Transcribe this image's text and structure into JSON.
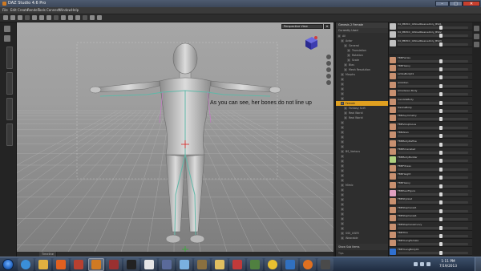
{
  "window": {
    "title": "DAZ Studio 4.6 Pro"
  },
  "menu": [
    {
      "label": "File"
    },
    {
      "label": "Edit"
    },
    {
      "label": "Create"
    },
    {
      "label": "Render"
    },
    {
      "label": "Tools"
    },
    {
      "label": "Connect"
    },
    {
      "label": "Window"
    },
    {
      "label": "Help"
    }
  ],
  "viewport": {
    "camera_dropdown": "Perspective View",
    "annotation": "As you can see, her bones do not line up"
  },
  "viewport_tabs": [
    {
      "label": "Timeline"
    }
  ],
  "scene": {
    "header": "Genesis 2 Female",
    "subheader": "Currently Used",
    "tree": [
      {
        "label": "All",
        "indent": 0
      },
      {
        "label": "Actor",
        "indent": 1
      },
      {
        "label": "General",
        "indent": 2
      },
      {
        "label": "Translation",
        "indent": 3
      },
      {
        "label": "Rotation",
        "indent": 3
      },
      {
        "label": "Scale",
        "indent": 3
      },
      {
        "label": "Bias",
        "indent": 2
      },
      {
        "label": "Mesh Resolution",
        "indent": 2
      },
      {
        "label": "Morphs",
        "indent": 1
      },
      {
        "label": "",
        "indent": 1
      },
      {
        "label": "",
        "indent": 1
      },
      {
        "label": "",
        "indent": 1
      },
      {
        "label": "",
        "indent": 1
      },
      {
        "label": "",
        "indent": 1
      },
      {
        "label": "Female",
        "indent": 1,
        "selected": true
      },
      {
        "label": "Fantasy Scifi",
        "indent": 2
      },
      {
        "label": "Real World",
        "indent": 2
      },
      {
        "label": "Real World",
        "indent": 2
      },
      {
        "label": "",
        "indent": 1
      },
      {
        "label": "",
        "indent": 1
      },
      {
        "label": "",
        "indent": 1
      },
      {
        "label": "",
        "indent": 1
      },
      {
        "label": "",
        "indent": 1
      },
      {
        "label": "",
        "indent": 1
      },
      {
        "label": "BS_Various",
        "indent": 1
      },
      {
        "label": "",
        "indent": 1
      },
      {
        "label": "",
        "indent": 1
      },
      {
        "label": "",
        "indent": 1
      },
      {
        "label": "",
        "indent": 1
      },
      {
        "label": "",
        "indent": 1
      },
      {
        "label": "",
        "indent": 1
      },
      {
        "label": "Mimic",
        "indent": 1
      },
      {
        "label": "",
        "indent": 1
      },
      {
        "label": "",
        "indent": 1
      },
      {
        "label": "",
        "indent": 1
      },
      {
        "label": "",
        "indent": 1
      },
      {
        "label": "",
        "indent": 1
      },
      {
        "label": "",
        "indent": 1
      },
      {
        "label": "",
        "indent": 1
      },
      {
        "label": "",
        "indent": 1
      },
      {
        "label": "",
        "indent": 1
      },
      {
        "label": "SSS_USER",
        "indent": 1
      },
      {
        "label": "Wearable",
        "indent": 1
      }
    ],
    "footer": "Show Sub Items",
    "footer2": "Tips"
  },
  "morphs": [
    {
      "name": "V4_PBMCC_04SkelPassiveOnly_BS01",
      "value": "",
      "level": 0.62,
      "thumb": "#c0c0c0"
    },
    {
      "name": "V4_PBMCC_04SkelPassiveOnly_BS02",
      "value": "",
      "level": 0.62,
      "thumb": "#c0c0c0"
    },
    {
      "name": "V4_PBMCC_04SkelPassiveOnly_BS03",
      "value": "",
      "level": 0.62,
      "thumb": "#c0c0c0"
    },
    {
      "name": "",
      "value": "",
      "level": 0.0,
      "thumb": "#2a2a2a"
    },
    {
      "name": "FBMFairies",
      "value": "",
      "level": 0.62,
      "thumb": "#c89070"
    },
    {
      "name": "FBMHeavy",
      "value": "",
      "level": 0.62,
      "thumb": "#c89070"
    },
    {
      "name": "LimbsBody01",
      "value": "",
      "level": 0.62,
      "thumb": "#c89070"
    },
    {
      "name": "Ambition",
      "value": "",
      "level": 0.62,
      "thumb": "#c89070"
    },
    {
      "name": "Amadeous Body",
      "value": "",
      "level": 0.62,
      "thumb": "#c89070"
    },
    {
      "name": "CandideBody",
      "value": "",
      "level": 0.62,
      "thumb": "#c89070"
    },
    {
      "name": "SiennaBody",
      "value": "",
      "level": 0.62,
      "thumb": "#c89070"
    },
    {
      "name": "FBMAsymmetry",
      "value": "",
      "level": 0.62,
      "thumb": "#c89070"
    },
    {
      "name": "FBMVoluptuous",
      "value": "",
      "level": 0.62,
      "thumb": "#c89070"
    },
    {
      "name": "FBMAlien",
      "value": "",
      "level": 0.62,
      "thumb": "#c89070"
    },
    {
      "name": "FBMBodyDefine",
      "value": "",
      "level": 0.62,
      "thumb": "#c89070"
    },
    {
      "name": "FBMEmaciated",
      "value": "",
      "level": 0.62,
      "thumb": "#c89070"
    },
    {
      "name": "FBMBodyBuilder",
      "value": "",
      "level": 0.62,
      "thumb": "#b0d080"
    },
    {
      "name": "FBMFitness",
      "value": "",
      "level": 0.62,
      "thumb": "#c89070"
    },
    {
      "name": "FBMHeight",
      "value": "",
      "level": 0.62,
      "thumb": "#c89070"
    },
    {
      "name": "FBMHeavy",
      "value": "",
      "level": 0.62,
      "thumb": "#c89070"
    },
    {
      "name": "FBMPearFigure",
      "value": "",
      "level": 0.62,
      "thumb": "#e0a0c0"
    },
    {
      "name": "FBMStylized",
      "value": "",
      "level": 0.62,
      "thumb": "#c89070"
    },
    {
      "name": "FBMStephanie5",
      "value": "",
      "level": 0.62,
      "thumb": "#c89070"
    },
    {
      "name": "FBMStephanie6",
      "value": "",
      "level": 0.62,
      "thumb": "#c89070"
    },
    {
      "name": "FBMStephanieCurvy",
      "value": "",
      "level": 0.62,
      "thumb": "#c89070"
    },
    {
      "name": "FBMThin",
      "value": "",
      "level": 0.62,
      "thumb": "#c89070"
    },
    {
      "name": "FBMYoungFemale",
      "value": "",
      "level": 0.62,
      "thumb": "#c89070"
    },
    {
      "name": "FBMYoungBody01",
      "value": "",
      "level": 0.62,
      "thumb": "#3070d0"
    }
  ],
  "taskbar": {
    "time": "1:11 PM",
    "date": "7/19/2013",
    "apps": [
      {
        "name": "ie",
        "color": "#3a8fd8"
      },
      {
        "name": "explorer",
        "color": "#e0b040"
      },
      {
        "name": "media",
        "color": "#e06020"
      },
      {
        "name": "app1",
        "color": "#b84030"
      },
      {
        "name": "daz",
        "color": "#d07a22"
      },
      {
        "name": "app2",
        "color": "#9a3030"
      },
      {
        "name": "app3",
        "color": "#222222"
      },
      {
        "name": "app4",
        "color": "#e6e6e6"
      },
      {
        "name": "app5",
        "color": "#5a6a9a"
      },
      {
        "name": "app6",
        "color": "#7ab0e0"
      },
      {
        "name": "app7",
        "color": "#8a7040"
      },
      {
        "name": "app8",
        "color": "#e0c060"
      },
      {
        "name": "app9",
        "color": "#c03a3a"
      },
      {
        "name": "app10",
        "color": "#508040"
      },
      {
        "name": "chrome",
        "color": "#e8c030"
      },
      {
        "name": "app11",
        "color": "#3070c0"
      },
      {
        "name": "firefox",
        "color": "#e07020"
      },
      {
        "name": "app12",
        "color": "#4a4a4a"
      }
    ]
  },
  "colors": {
    "selection": "#e0a020",
    "bone": "#5fb8a8",
    "figure": "#c8c8c8"
  }
}
